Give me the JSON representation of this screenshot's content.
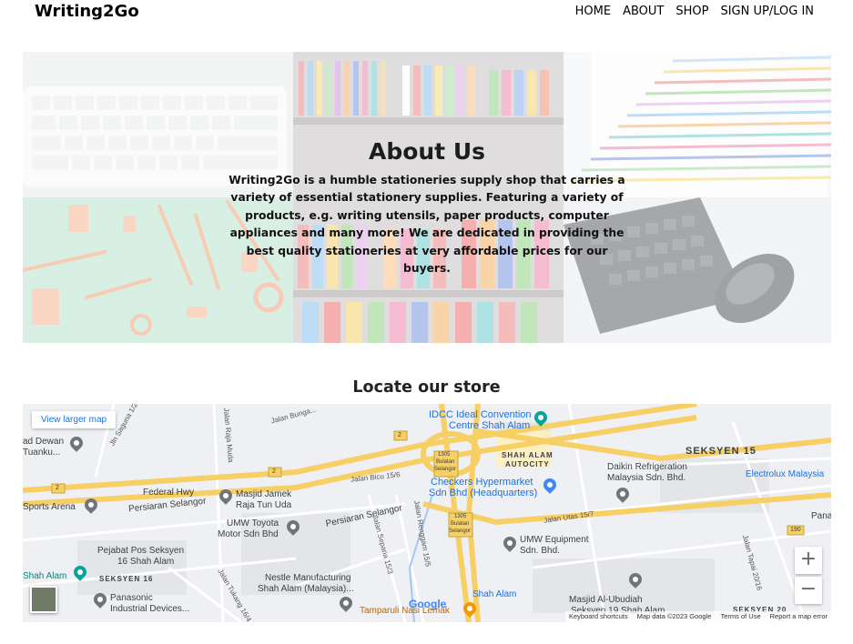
{
  "navbar": {
    "brand": "Writing2Go",
    "links": [
      "HOME",
      "ABOUT",
      "SHOP",
      "SIGN UP/LOG IN"
    ]
  },
  "about": {
    "title": "About Us",
    "text": "Writing2Go is a humble stationeries supply shop that carries a variety of essential stationery supplies. Featuring a variety of products, e.g. writing utensils, paper products, computer appliances and many more! We are dedicated in providing the best quality stationeries at very affordable prices for our buyers."
  },
  "locate": {
    "title": "Locate our store"
  },
  "map": {
    "view_larger": "View larger map",
    "zoom_in": "+",
    "zoom_out": "−",
    "google": "Google",
    "attribution": [
      "Keyboard shortcuts",
      "Map data ©2023 Google",
      "Terms of Use",
      "Report a map error"
    ],
    "labels": {
      "idcc": "IDCC Ideal Convention",
      "idcc2": "Centre Shah Alam",
      "seksyen15": "SEKSYEN 15",
      "daikin1": "Daikin Refrigeration",
      "daikin2": "Malaysia Sdn. Bhd.",
      "electrolux": "Electrolux Malaysia",
      "checkers1": "Checkers Hypermarket",
      "checkers2": "Sdn Bhd (Headquarters)",
      "autocity1": "SHAH ALAM",
      "autocity2": "AUTOCITY",
      "federal": "Federal Hwy",
      "persiaran1": "Persiaran Selangor",
      "persiaran2": "Persiaran Selangor",
      "sports": "Sports Arena",
      "masjid1": "Masjid Jamek",
      "masjid2": "Raja Tun Uda",
      "umwtoyota1": "UMW Toyota",
      "umwtoyota2": "Motor Sdn Bhd",
      "umweq1": "UMW Equipment",
      "umweq2": "Sdn. Bhd.",
      "pejabat1": "Pejabat Pos Seksyen",
      "pejabat2": "16 Shah Alam",
      "shahalam": "Shah Alam",
      "shahalam2": "Shah Alam",
      "seksyen16": "SEKSYEN 16",
      "panasonic1": "Panasonic",
      "panasonic2": "Industrial Devices...",
      "nestle1": "Nestle Manufacturing",
      "nestle2": "Shah Alam (Malaysia)...",
      "tamparuli": "Tamparuli Nasi Lemak",
      "masjidubu1": "Masjid Al-Ubudiah",
      "masjidubu2": "Seksyen 19 Shah Alam",
      "seksyen20": "SEKSYEN 20",
      "dewan1": "ad Dewan",
      "dewan2": "Tuanku...",
      "jalanbicu": "Jalan Bicu 15/6",
      "jalanutas": "Jalan Utas 15/7",
      "jalanrajamuda": "Jalan Raja Muda",
      "jalansepana": "Jalan Sepana 15/3",
      "jalanrenggam": "Jalan Renggam 15/5",
      "jalantapai": "Jalan Tapai 20/16",
      "jalantukang": "Jalan Tukang 16/4",
      "jalanbunga": "Jalan Bunga...",
      "jalansaguna": "Jln Saguna 1/2",
      "bulatan1": "1305",
      "bulatan1b": "Bulatan",
      "bulatan1c": "Selangor",
      "bulatan2": "1305",
      "bulatan2b": "Bulatan",
      "bulatan2c": "Selangor",
      "route2a": "2",
      "route2b": "2",
      "route2c": "2",
      "route190": "190",
      "pana": "Pana"
    }
  }
}
